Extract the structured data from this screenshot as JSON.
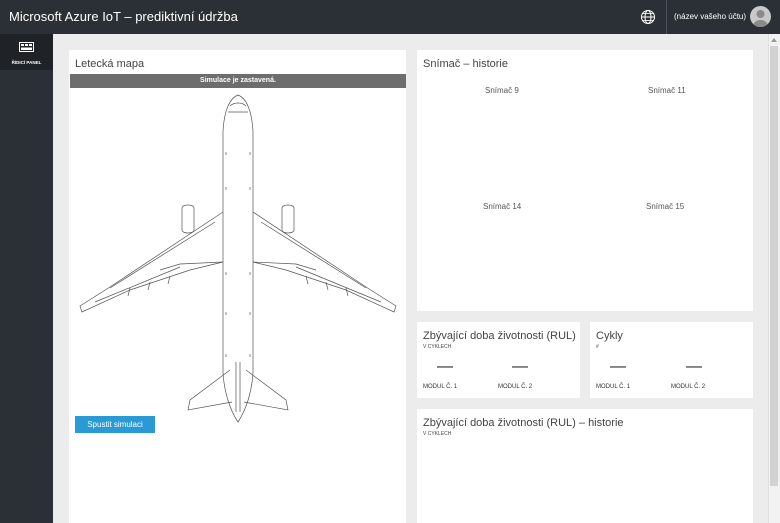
{
  "header": {
    "title": "Microsoft Azure IoT – prediktivní údržba",
    "account": "(název vašeho účtu)"
  },
  "sidebar": {
    "items": [
      {
        "label": "ŘÍDICÍ PANEL"
      }
    ]
  },
  "map": {
    "title": "Letecká mapa",
    "status": "Simulace je zastavená.",
    "start_button": "Spustit simulaci"
  },
  "sensors": {
    "title": "Snímač – historie",
    "labels": [
      "Snímač 9",
      "Snímač 11",
      "Snímač 14",
      "Snímač 15"
    ]
  },
  "rul": {
    "title": "Zbývající doba životnosti (RUL)",
    "subtitle": "V CYKLECH",
    "values": [
      "—",
      "—"
    ],
    "labels": [
      "MODUL Č. 1",
      "MODUL Č. 2"
    ]
  },
  "cycles": {
    "title": "Cykly",
    "subtitle": "#",
    "values": [
      "—",
      "—"
    ],
    "labels": [
      "MODUL Č. 1",
      "MODUL Č. 2"
    ]
  },
  "rul_history": {
    "title": "Zbývající doba životnosti (RUL) – historie",
    "subtitle": "V CYKLECH"
  },
  "colors": {
    "topbar": "#2b3036",
    "accent": "#2a9ad6",
    "status_bar": "#6d6d6d"
  },
  "icons": {
    "globe": "globe-icon",
    "avatar": "user-avatar-icon",
    "dashboard": "dashboard-icon"
  }
}
